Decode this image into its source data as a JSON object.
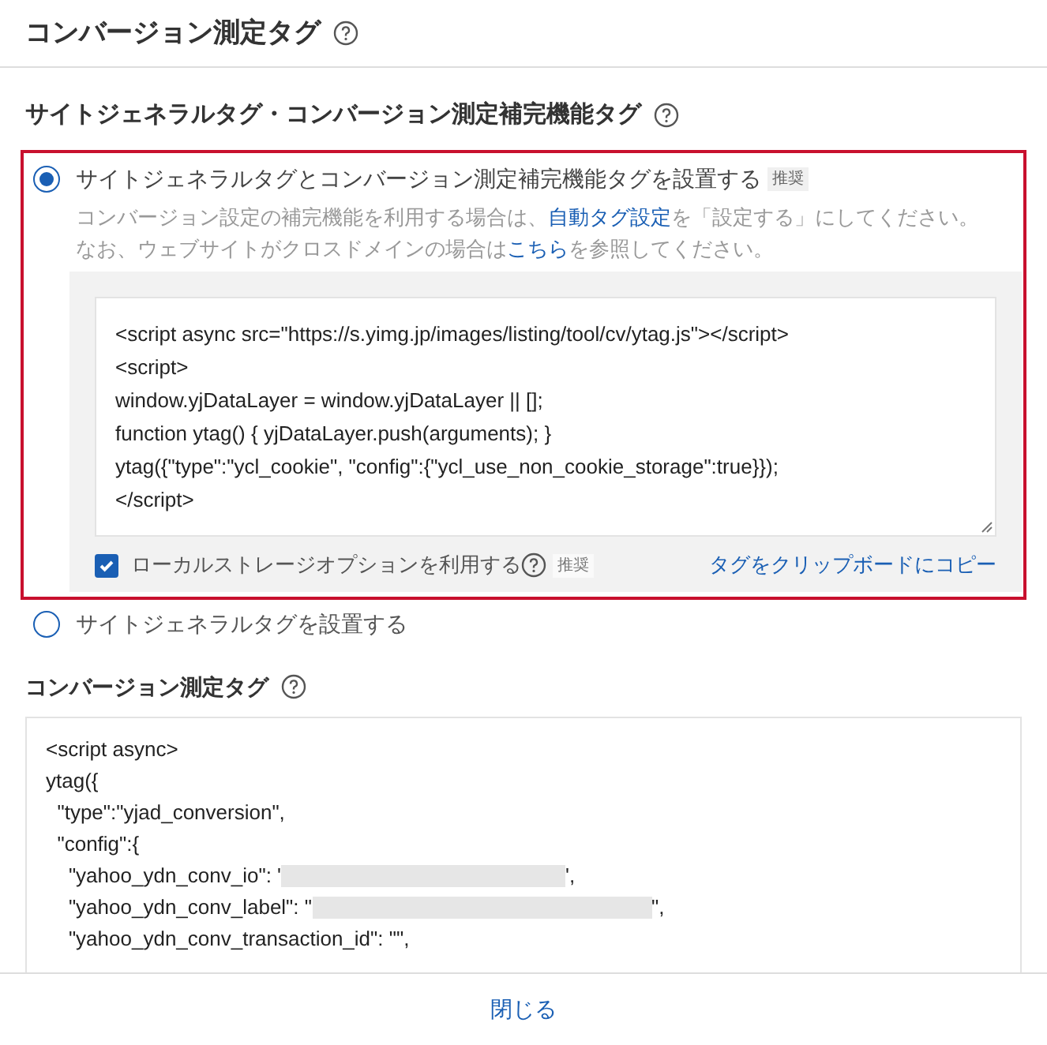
{
  "title": "コンバージョン測定タグ",
  "site_section": {
    "heading": "サイトジェネラルタグ・コンバージョン測定補完機能タグ",
    "options": [
      {
        "label": "サイトジェネラルタグとコンバージョン測定補完機能タグを設置する",
        "badge": "推奨",
        "selected": true,
        "notes": [
          {
            "before": "コンバージョン設定の補完機能を利用する場合は、",
            "link": "自動タグ設定",
            "after": "を「設定する」にしてください。"
          },
          {
            "before": "なお、ウェブサイトがクロスドメインの場合は",
            "link": "こちら",
            "after": "を参照してください。"
          }
        ],
        "code": [
          "<script async src=\"https://s.yimg.jp/images/listing/tool/cv/ytag.js\"></script>",
          "<script>",
          "window.yjDataLayer = window.yjDataLayer || [];",
          "function ytag() { yjDataLayer.push(arguments); }",
          "ytag({\"type\":\"ycl_cookie\", \"config\":{\"ycl_use_non_cookie_storage\":true}});",
          "</script>"
        ],
        "local_storage": {
          "label": "ローカルストレージオプションを利用する",
          "badge": "推奨",
          "checked": true
        },
        "copy_link": "タグをクリップボードにコピー"
      },
      {
        "label": "サイトジェネラルタグを設置する",
        "selected": false
      }
    ]
  },
  "conversion_section": {
    "heading": "コンバージョン測定タグ",
    "code": [
      {
        "text": "<script async>"
      },
      {
        "text": "ytag({"
      },
      {
        "text": "  \"type\":\"yjad_conversion\","
      },
      {
        "text": "  \"config\":{"
      },
      {
        "text": "    \"yahoo_ydn_conv_io\": '",
        "redacted": true,
        "after": "',"
      },
      {
        "text": "    \"yahoo_ydn_conv_label\": \"",
        "redacted": true,
        "after": "\","
      },
      {
        "text": "    \"yahoo_ydn_conv_transaction_id\": \"\","
      }
    ]
  },
  "close_button": "閉じる"
}
